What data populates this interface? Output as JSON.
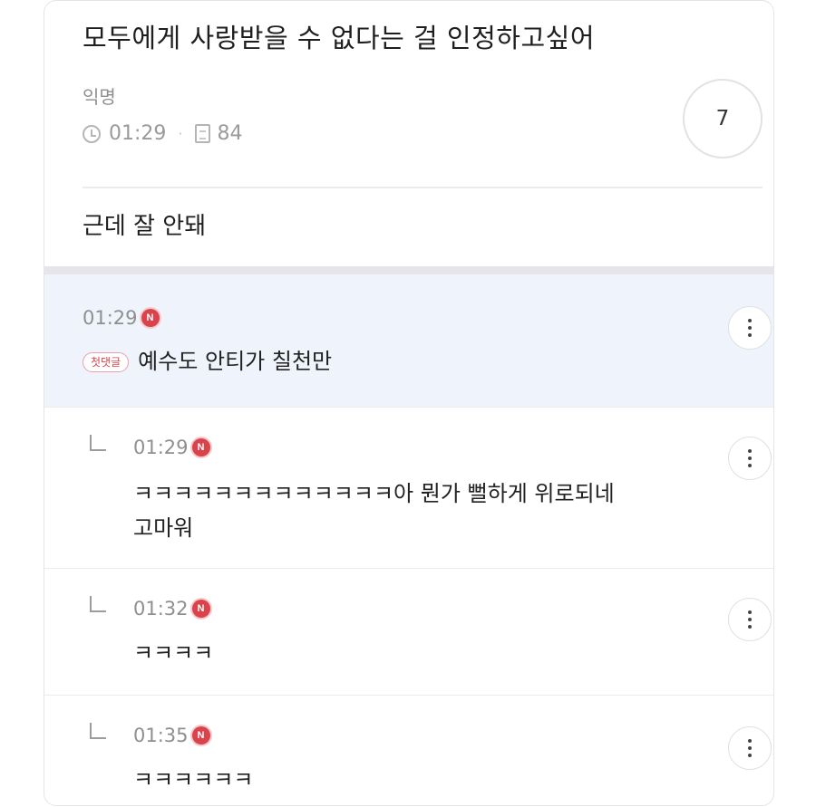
{
  "post": {
    "title": "모두에게 사랑받을 수 없다는 걸 인정하고싶어",
    "author": "익명",
    "time": "01:29",
    "views": "84",
    "comment_count": "7",
    "body": "근데 잘 안돼"
  },
  "icons": [
    "clock-icon",
    "document-icon",
    "new-badge-icon",
    "reply-arrow-icon",
    "more-options-icon"
  ],
  "colors": {
    "badge": "#d9434b",
    "highlight_bg": "#eef3fc"
  },
  "comments": [
    {
      "time": "01:29",
      "badge": "N",
      "tag": "첫댓글",
      "text": "예수도 안티가 칠천만"
    },
    {
      "time": "01:29",
      "badge": "N",
      "line1": "ㅋㅋㅋㅋㅋㅋㅋㅋㅋㅋㅋㅋㅋ아 뭔가 뻘하게 위로되네",
      "line2": "고마워"
    },
    {
      "time": "01:32",
      "badge": "N",
      "text": "ㅋㅋㅋㅋ"
    },
    {
      "time": "01:35",
      "badge": "N",
      "text": "ㅋㅋㅋㅋㅋㅋ"
    }
  ]
}
